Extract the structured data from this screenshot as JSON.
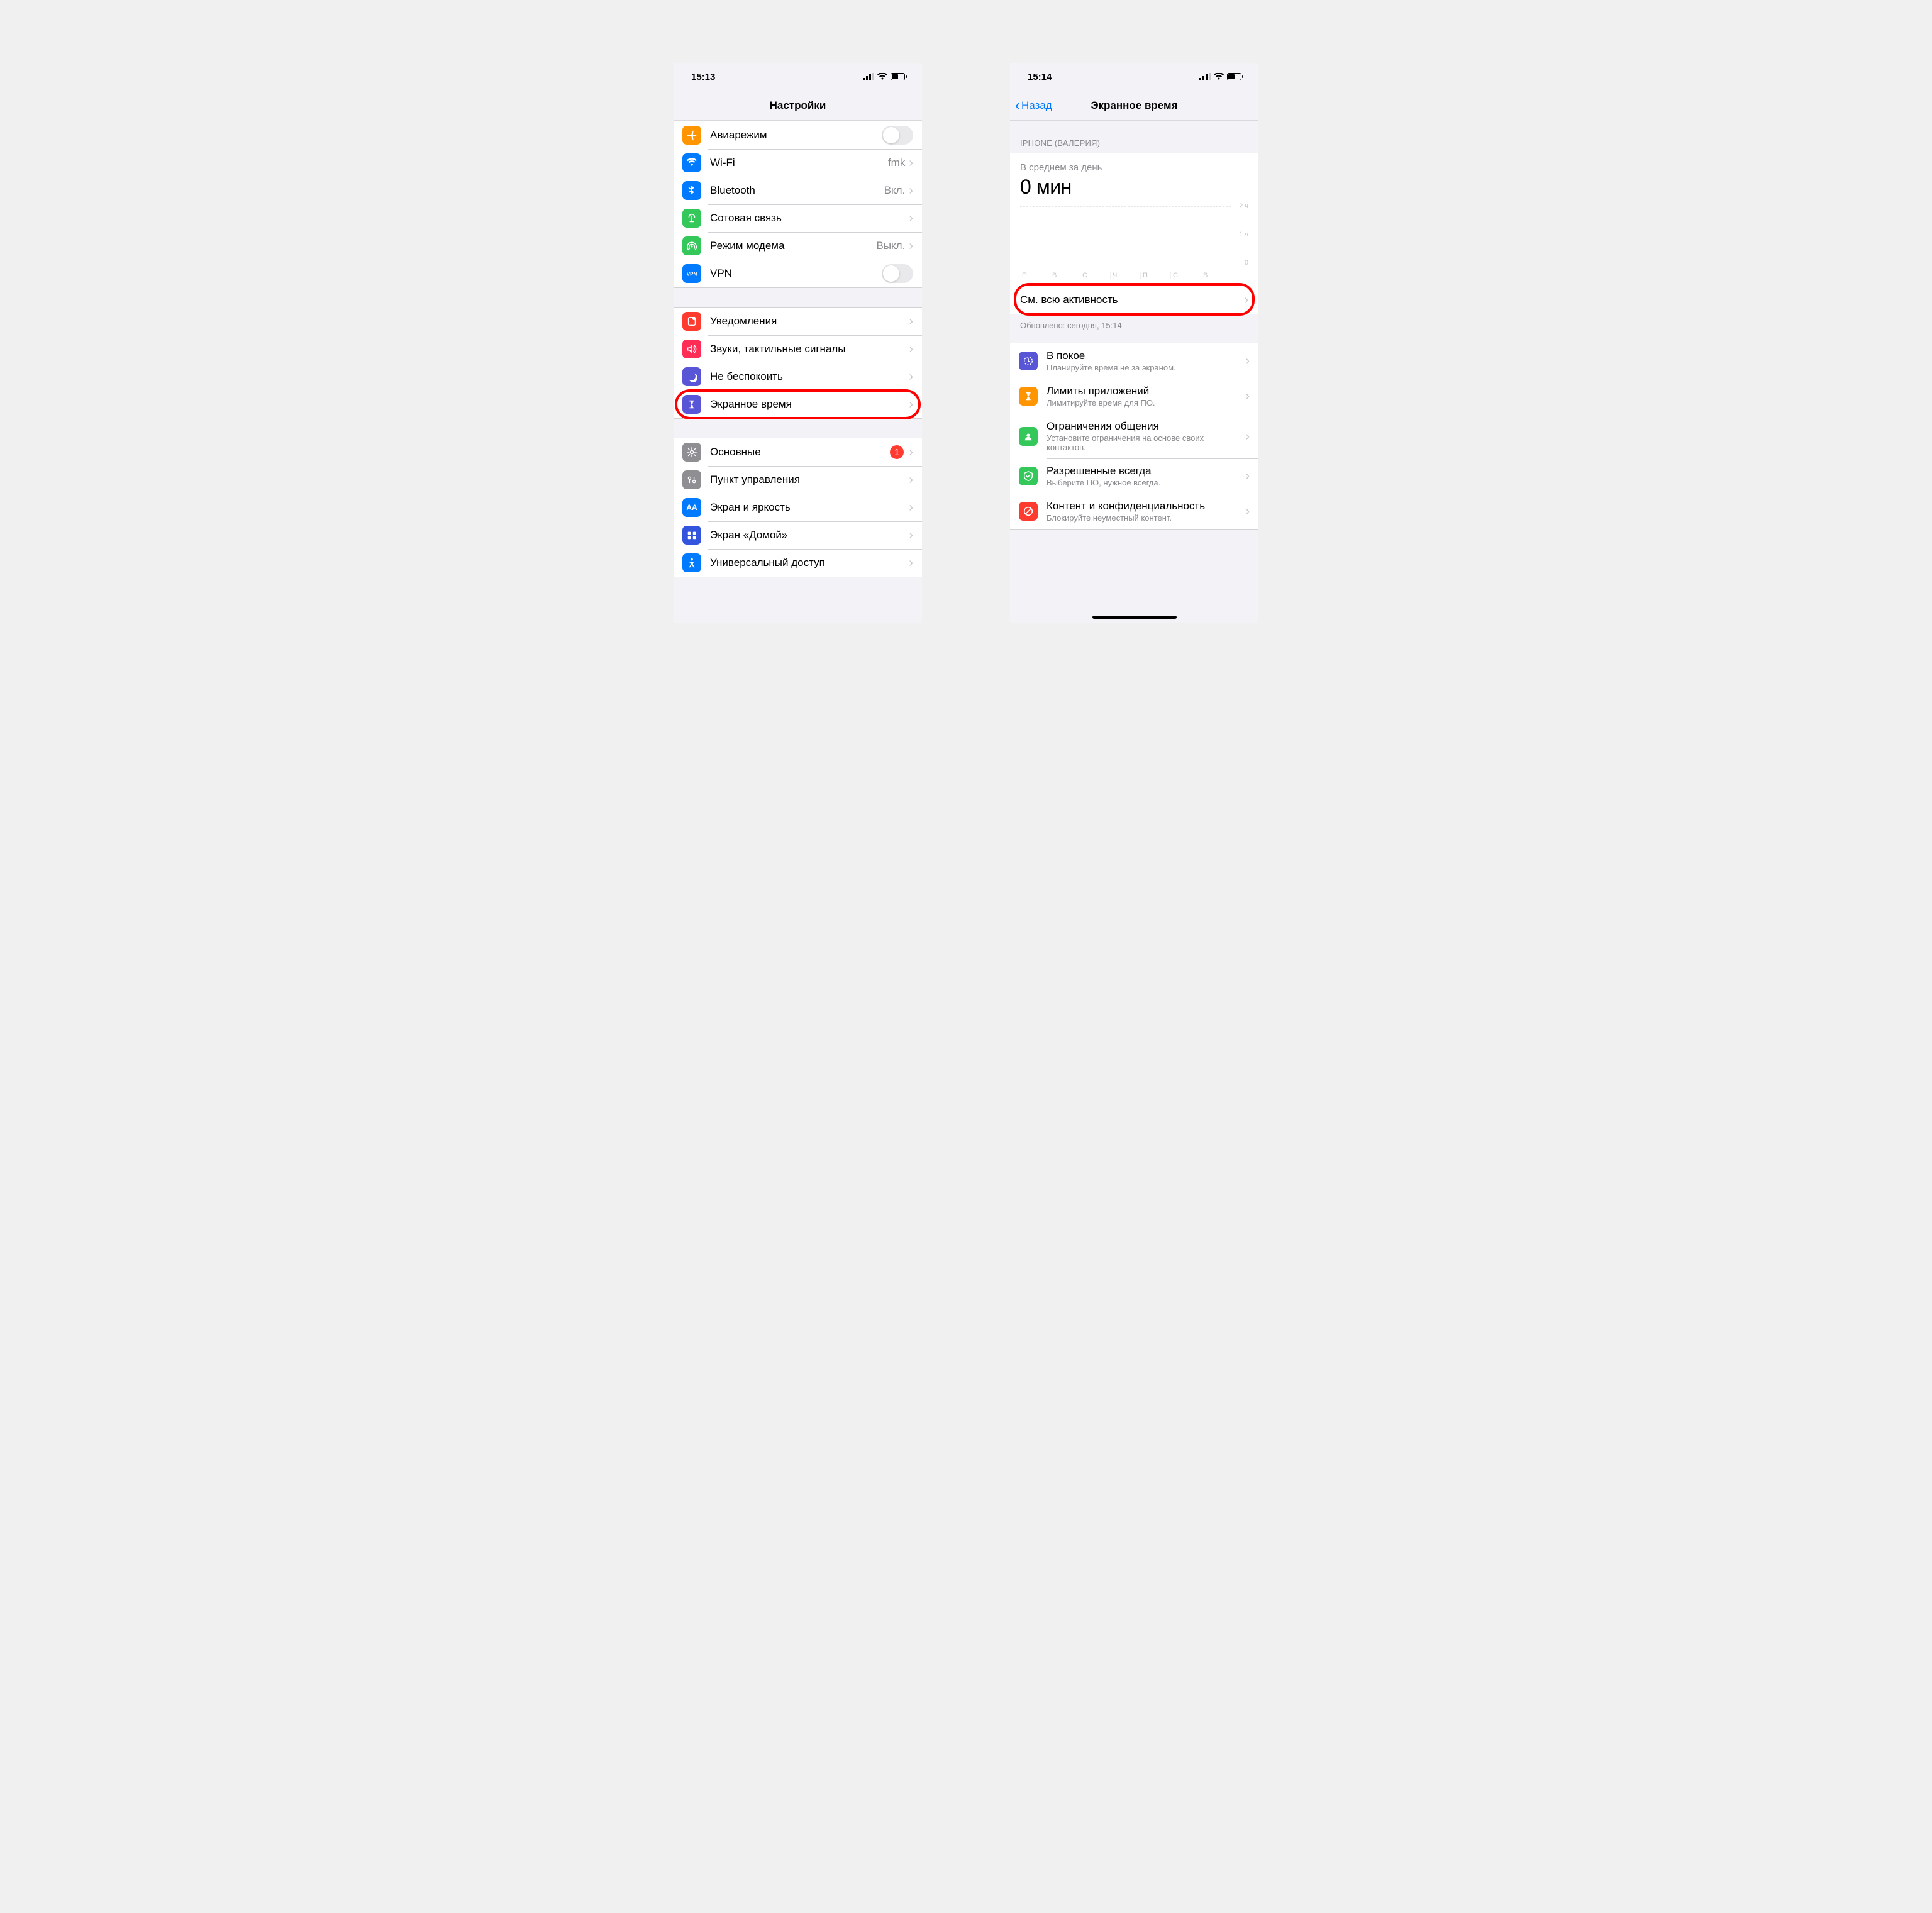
{
  "left": {
    "status_time": "15:13",
    "nav_title": "Настройки",
    "groups": [
      [
        {
          "icon": "airplane",
          "color": "#ff9500",
          "label": "Авиарежим",
          "kind": "switch"
        },
        {
          "icon": "wifi",
          "color": "#007aff",
          "label": "Wi-Fi",
          "value": "fmk",
          "kind": "link"
        },
        {
          "icon": "bluetooth",
          "color": "#007aff",
          "label": "Bluetooth",
          "value": "Вкл.",
          "kind": "link"
        },
        {
          "icon": "cellular",
          "color": "#34c759",
          "label": "Сотовая связь",
          "kind": "link"
        },
        {
          "icon": "hotspot",
          "color": "#34c759",
          "label": "Режим модема",
          "value": "Выкл.",
          "kind": "link"
        },
        {
          "icon": "vpn",
          "color": "#007aff",
          "label": "VPN",
          "kind": "switch"
        }
      ],
      [
        {
          "icon": "notifications",
          "color": "#ff3b30",
          "label": "Уведомления",
          "kind": "link"
        },
        {
          "icon": "sounds",
          "color": "#ff2d55",
          "label": "Звуки, тактильные сигналы",
          "kind": "link"
        },
        {
          "icon": "dnd",
          "color": "#5856d6",
          "label": "Не беспокоить",
          "kind": "link"
        },
        {
          "icon": "screentime",
          "color": "#5856d6",
          "label": "Экранное время",
          "kind": "link",
          "highlight": true
        }
      ],
      [
        {
          "icon": "general",
          "color": "#8e8e93",
          "label": "Основные",
          "badge": "1",
          "kind": "link"
        },
        {
          "icon": "control",
          "color": "#8e8e93",
          "label": "Пункт управления",
          "kind": "link"
        },
        {
          "icon": "display",
          "color": "#007aff",
          "label": "Экран и яркость",
          "kind": "link",
          "textIcon": "AA"
        },
        {
          "icon": "home",
          "color": "#3355dd",
          "label": "Экран «Домой»",
          "kind": "link"
        },
        {
          "icon": "accessibility",
          "color": "#007aff",
          "label": "Универсальный доступ",
          "kind": "link"
        }
      ]
    ]
  },
  "right": {
    "status_time": "15:14",
    "nav_back": "Назад",
    "nav_title": "Экранное время",
    "device_header": "IPHONE (ВАЛЕРИЯ)",
    "avg_label": "В среднем за день",
    "avg_value": "0 мин",
    "yticks": [
      "2 ч",
      "1 ч",
      "0"
    ],
    "days": [
      "П",
      "В",
      "С",
      "Ч",
      "П",
      "С",
      "В"
    ],
    "activity_row": "См. всю активность",
    "updated": "Обновлено: сегодня, 15:14",
    "options": [
      {
        "icon": "downtime",
        "color": "#5856d6",
        "title": "В покое",
        "sub": "Планируйте время не за экраном."
      },
      {
        "icon": "applimits",
        "color": "#ff9500",
        "title": "Лимиты приложений",
        "sub": "Лимитируйте время для ПО."
      },
      {
        "icon": "commlimits",
        "color": "#34c759",
        "title": "Ограничения общения",
        "sub": "Установите ограничения на основе своих контактов."
      },
      {
        "icon": "allowed",
        "color": "#34c759",
        "title": "Разрешенные всегда",
        "sub": "Выберите ПО, нужное всегда."
      },
      {
        "icon": "content",
        "color": "#ff3b30",
        "title": "Контент и конфиденциальность",
        "sub": "Блокируйте неуместный контент."
      }
    ]
  },
  "chart_data": {
    "type": "bar",
    "categories": [
      "П",
      "В",
      "С",
      "Ч",
      "П",
      "С",
      "В"
    ],
    "values": [
      0,
      0,
      0,
      0,
      0,
      0,
      0
    ],
    "title": "В среднем за день",
    "ylabel": "ч",
    "ylim": [
      0,
      2
    ],
    "yticks": [
      0,
      1,
      2
    ]
  }
}
